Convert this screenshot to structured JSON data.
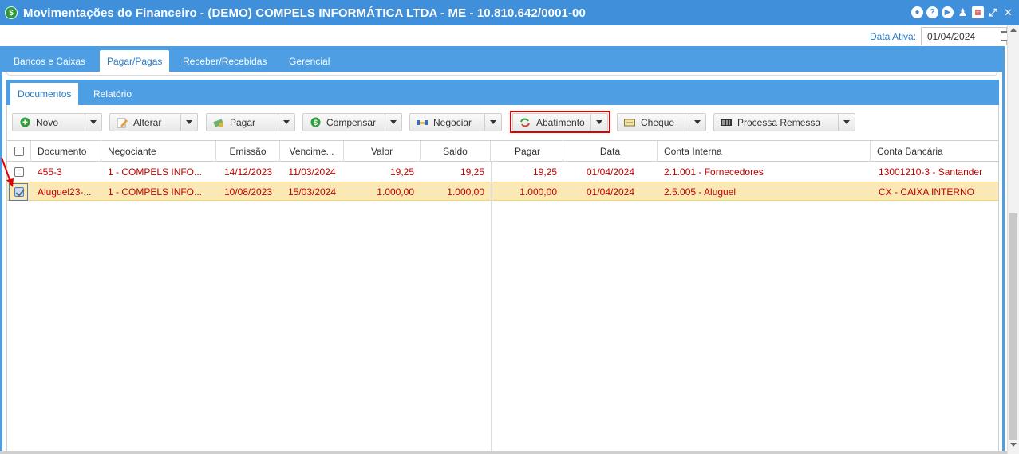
{
  "window": {
    "title": "Movimentações do Financeiro - (DEMO) COMPELS INFORMÁTICA LTDA - ME - 10.810.642/0001-00",
    "app_icon": "$"
  },
  "active_date": {
    "label": "Data Ativa:",
    "value": "01/04/2024"
  },
  "main_tabs": [
    {
      "label": "Bancos e Caixas",
      "active": false
    },
    {
      "label": "Pagar/Pagas",
      "active": true
    },
    {
      "label": "Receber/Recebidas",
      "active": false
    },
    {
      "label": "Gerencial",
      "active": false
    }
  ],
  "sub_tabs": [
    {
      "label": "Documentos",
      "active": true
    },
    {
      "label": "Relatório",
      "active": false
    }
  ],
  "toolbar": {
    "novo": "Novo",
    "alterar": "Alterar",
    "pagar": "Pagar",
    "compensar": "Compensar",
    "negociar": "Negociar",
    "abatimento": "Abatimento",
    "cheque": "Cheque",
    "processa_remessa": "Processa Remessa"
  },
  "columns": {
    "documento": "Documento",
    "negociante": "Negociante",
    "emissao": "Emissão",
    "vencimento": "Vencime...",
    "valor": "Valor",
    "saldo": "Saldo",
    "pagar": "Pagar",
    "data": "Data",
    "conta_interna": "Conta Interna",
    "conta_bancaria": "Conta Bancária"
  },
  "rows": [
    {
      "checked": false,
      "selected": false,
      "documento": "455-3",
      "negociante": "1 - COMPELS INFO...",
      "emissao": "14/12/2023",
      "vencimento": "11/03/2024",
      "valor": "19,25",
      "saldo": "19,25",
      "pagar": "19,25",
      "data": "01/04/2024",
      "conta_interna": "2.1.001 - Fornecedores",
      "conta_bancaria": "13001210-3 - Santander"
    },
    {
      "checked": true,
      "selected": true,
      "documento": "Aluguel23-...",
      "negociante": "1 - COMPELS INFO...",
      "emissao": "10/08/2023",
      "vencimento": "15/03/2024",
      "valor": "1.000,00",
      "saldo": "1.000,00",
      "pagar": "1.000,00",
      "data": "01/04/2024",
      "conta_interna": "2.5.005 - Aluguel",
      "conta_bancaria": "CX - CAIXA INTERNO"
    }
  ],
  "colors": {
    "title_bar": "#3f8fdb",
    "tab_bar": "#4e9ee3",
    "row_text": "#c20000",
    "selected_row": "#fbe9b5",
    "highlight_border": "#e00000"
  }
}
